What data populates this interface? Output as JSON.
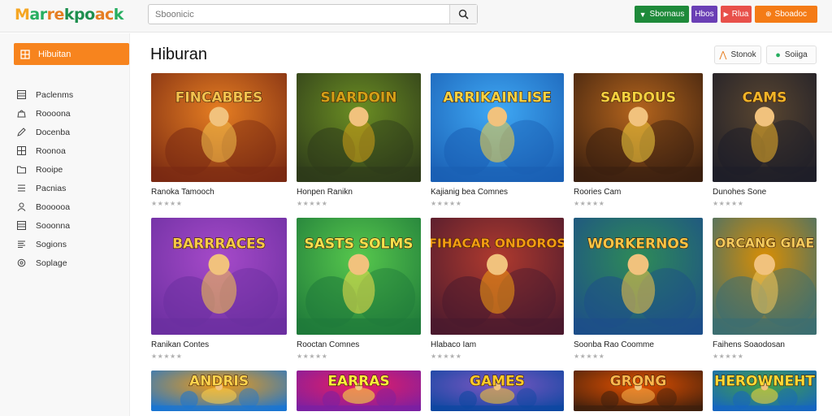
{
  "header": {
    "logo_text": "Marrekpoack",
    "search_placeholder": "Sboonicic",
    "buttons": [
      {
        "label": "Sbornaus",
        "color": "#1e8a3a",
        "icon": "twitter-bird-icon"
      },
      {
        "label": "Hbos",
        "color": "#6a3fb5"
      },
      {
        "label": "Rlua",
        "color": "#e8504a",
        "icon": "play-icon"
      },
      {
        "label": "Sboadoc",
        "color": "#f47b16",
        "icon": "cart-icon"
      }
    ]
  },
  "sidebar": {
    "active": {
      "label": "Hibuitan",
      "icon": "grid-icon"
    },
    "items": [
      {
        "label": "Paclenms",
        "icon": "list-icon"
      },
      {
        "label": "Roooona",
        "icon": "bag-icon"
      },
      {
        "label": "Docenba",
        "icon": "edit-icon"
      },
      {
        "label": "Roonoa",
        "icon": "table-icon"
      },
      {
        "label": "Rooipe",
        "icon": "folder-icon"
      },
      {
        "label": "Pacnias",
        "icon": "menu-icon"
      },
      {
        "label": "Boooooa",
        "icon": "user-icon"
      },
      {
        "label": "Sooonna",
        "icon": "list-icon"
      },
      {
        "label": "Sogions",
        "icon": "lines-icon"
      },
      {
        "label": "Soplage",
        "icon": "settings-icon"
      }
    ]
  },
  "main": {
    "title": "Hiburan",
    "toolbar": [
      {
        "label": "Stonok",
        "icon": "tag-icon"
      },
      {
        "label": "Soiiga",
        "icon": "globe-icon"
      }
    ],
    "rating_glyphs": "★★★★★",
    "cards": [
      {
        "title": "Ranoka Tamooch",
        "art_text": "FINCABBES",
        "palette": [
          "#7a2a12",
          "#e67e22",
          "#f2c14e"
        ]
      },
      {
        "title": "Honpen Ranikn",
        "art_text": "SIARDOIN",
        "palette": [
          "#2d3a1a",
          "#6b8e23",
          "#d4a017"
        ]
      },
      {
        "title": "Kajianig bea Comnes",
        "art_text": "ARRIKAINLISE",
        "palette": [
          "#1a5fb4",
          "#3fa9f5",
          "#f5d142"
        ]
      },
      {
        "title": "Roories Cam",
        "art_text": "SABDOUS",
        "palette": [
          "#3a1f0f",
          "#b5651d",
          "#f4d03f"
        ]
      },
      {
        "title": "Dunohes Sone",
        "art_text": "CAMS",
        "palette": [
          "#1e1e28",
          "#5a4630",
          "#f0b429"
        ]
      },
      {
        "title": "Ranikan Contes",
        "art_text": "BARRRACES",
        "palette": [
          "#6b2fa0",
          "#a64ac9",
          "#f7c948"
        ]
      },
      {
        "title": "Rooctan Comnes",
        "art_text": "SASTS SOLMS",
        "palette": [
          "#1f7a3a",
          "#57c84d",
          "#f4e04d"
        ]
      },
      {
        "title": "Hlabaco Iam",
        "art_text": "FIHACAR ONDOROS",
        "palette": [
          "#4a1a2e",
          "#b03a2e",
          "#f39c12"
        ]
      },
      {
        "title": "Soonba Rao Coomme",
        "art_text": "WORKERNOS",
        "palette": [
          "#1d4e89",
          "#2e8b57",
          "#f6c445"
        ]
      },
      {
        "title": "Faihens Soaodosan",
        "art_text": "ORCANG GIAE",
        "palette": [
          "#3c6e71",
          "#d98e04",
          "#f5cb5c"
        ]
      },
      {
        "title": "",
        "art_text": "ANDRIS",
        "palette": [
          "#1a75d2",
          "#f39c12",
          "#ffd34d"
        ]
      },
      {
        "title": "",
        "art_text": "EARRAS",
        "palette": [
          "#7b1fa2",
          "#e91e63",
          "#ffeb3b"
        ]
      },
      {
        "title": "",
        "art_text": "GAMES",
        "palette": [
          "#0d47a1",
          "#7e57c2",
          "#ffca28"
        ]
      },
      {
        "title": "",
        "art_text": "GRONG",
        "palette": [
          "#3e1f0d",
          "#e65100",
          "#ffb74d"
        ]
      },
      {
        "title": "",
        "art_text": "HEROWNEHT",
        "palette": [
          "#1565c0",
          "#43a047",
          "#fdd835"
        ]
      }
    ]
  }
}
